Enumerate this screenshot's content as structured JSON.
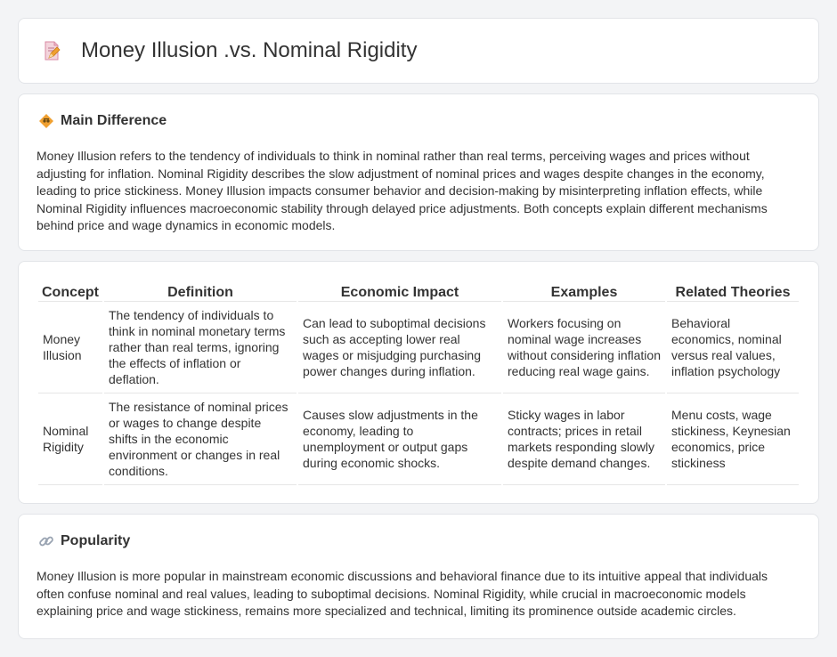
{
  "header": {
    "title": "Money Illusion .vs. Nominal Rigidity",
    "icon": "document-edit-icon"
  },
  "main_difference": {
    "icon": "diamond-icon",
    "title": "Main Difference",
    "text": "Money Illusion refers to the tendency of individuals to think in nominal rather than real terms, perceiving wages and prices without adjusting for inflation. Nominal Rigidity describes the slow adjustment of nominal prices and wages despite changes in the economy, leading to price stickiness. Money Illusion impacts consumer behavior and decision-making by misinterpreting inflation effects, while Nominal Rigidity influences macroeconomic stability through delayed price adjustments. Both concepts explain different mechanisms behind price and wage dynamics in economic models."
  },
  "comparison_table": {
    "headers": [
      "Concept",
      "Definition",
      "Economic Impact",
      "Examples",
      "Related Theories"
    ],
    "rows": [
      {
        "concept": "Money Illusion",
        "definition": "The tendency of individuals to think in nominal monetary terms rather than real terms, ignoring the effects of inflation or deflation.",
        "impact": "Can lead to suboptimal decisions such as accepting lower real wages or misjudging purchasing power changes during inflation.",
        "examples": "Workers focusing on nominal wage increases without considering inflation reducing real wage gains.",
        "theories": "Behavioral economics, nominal versus real values, inflation psychology"
      },
      {
        "concept": "Nominal Rigidity",
        "definition": "The resistance of nominal prices or wages to change despite shifts in the economic environment or changes in real conditions.",
        "impact": "Causes slow adjustments in the economy, leading to unemployment or output gaps during economic shocks.",
        "examples": "Sticky wages in labor contracts; prices in retail markets responding slowly despite demand changes.",
        "theories": "Menu costs, wage stickiness, Keynesian economics, price stickiness"
      }
    ]
  },
  "popularity": {
    "icon": "link-icon",
    "title": "Popularity",
    "text": "Money Illusion is more popular in mainstream economic discussions and behavioral finance due to its intuitive appeal that individuals often confuse nominal and real values, leading to suboptimal decisions. Nominal Rigidity, while crucial in macroeconomic models explaining price and wage stickiness, remains more specialized and technical, limiting its prominence outside academic circles."
  },
  "colors": {
    "background": "#f3f4f6",
    "card": "#ffffff",
    "text": "#333333",
    "accent_orange": "#f0a030",
    "icon_pink": "#e7709b"
  }
}
